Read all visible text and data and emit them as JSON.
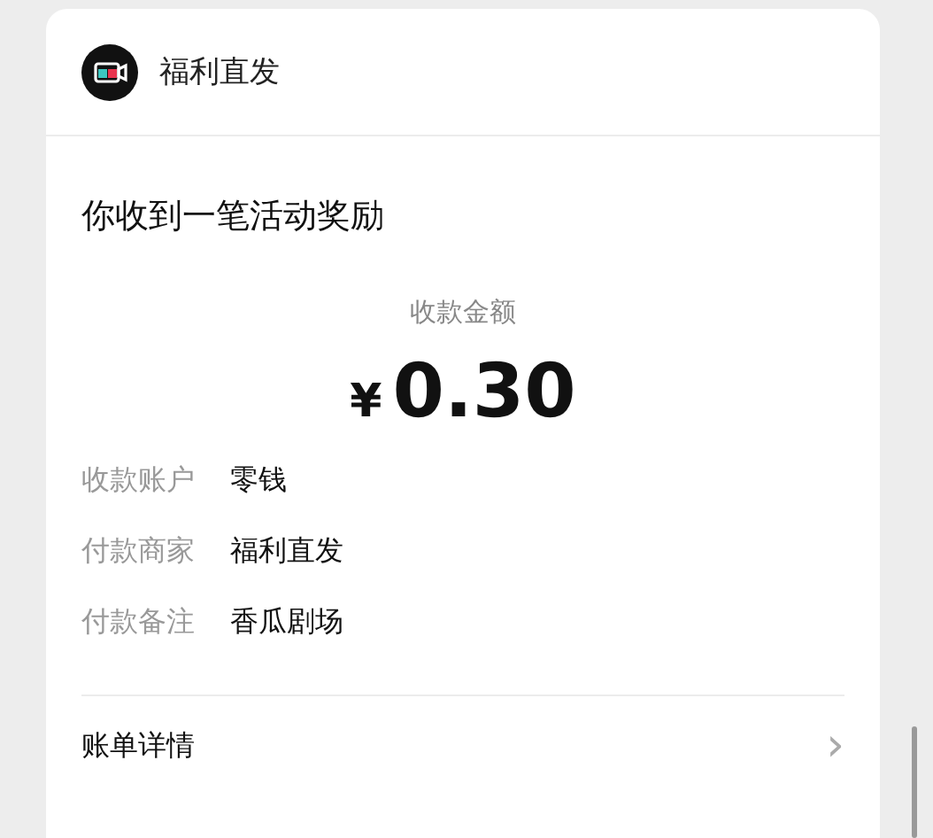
{
  "header": {
    "sender": "福利直发"
  },
  "message": "你收到一笔活动奖励",
  "amount": {
    "label": "收款金额",
    "currency": "¥",
    "value": "0.30"
  },
  "details": [
    {
      "label": "收款账户",
      "value": "零钱"
    },
    {
      "label": "付款商家",
      "value": "福利直发"
    },
    {
      "label": "付款备注",
      "value": "香瓜剧场"
    }
  ],
  "footer": {
    "label": "账单详情",
    "chevron": "›"
  }
}
